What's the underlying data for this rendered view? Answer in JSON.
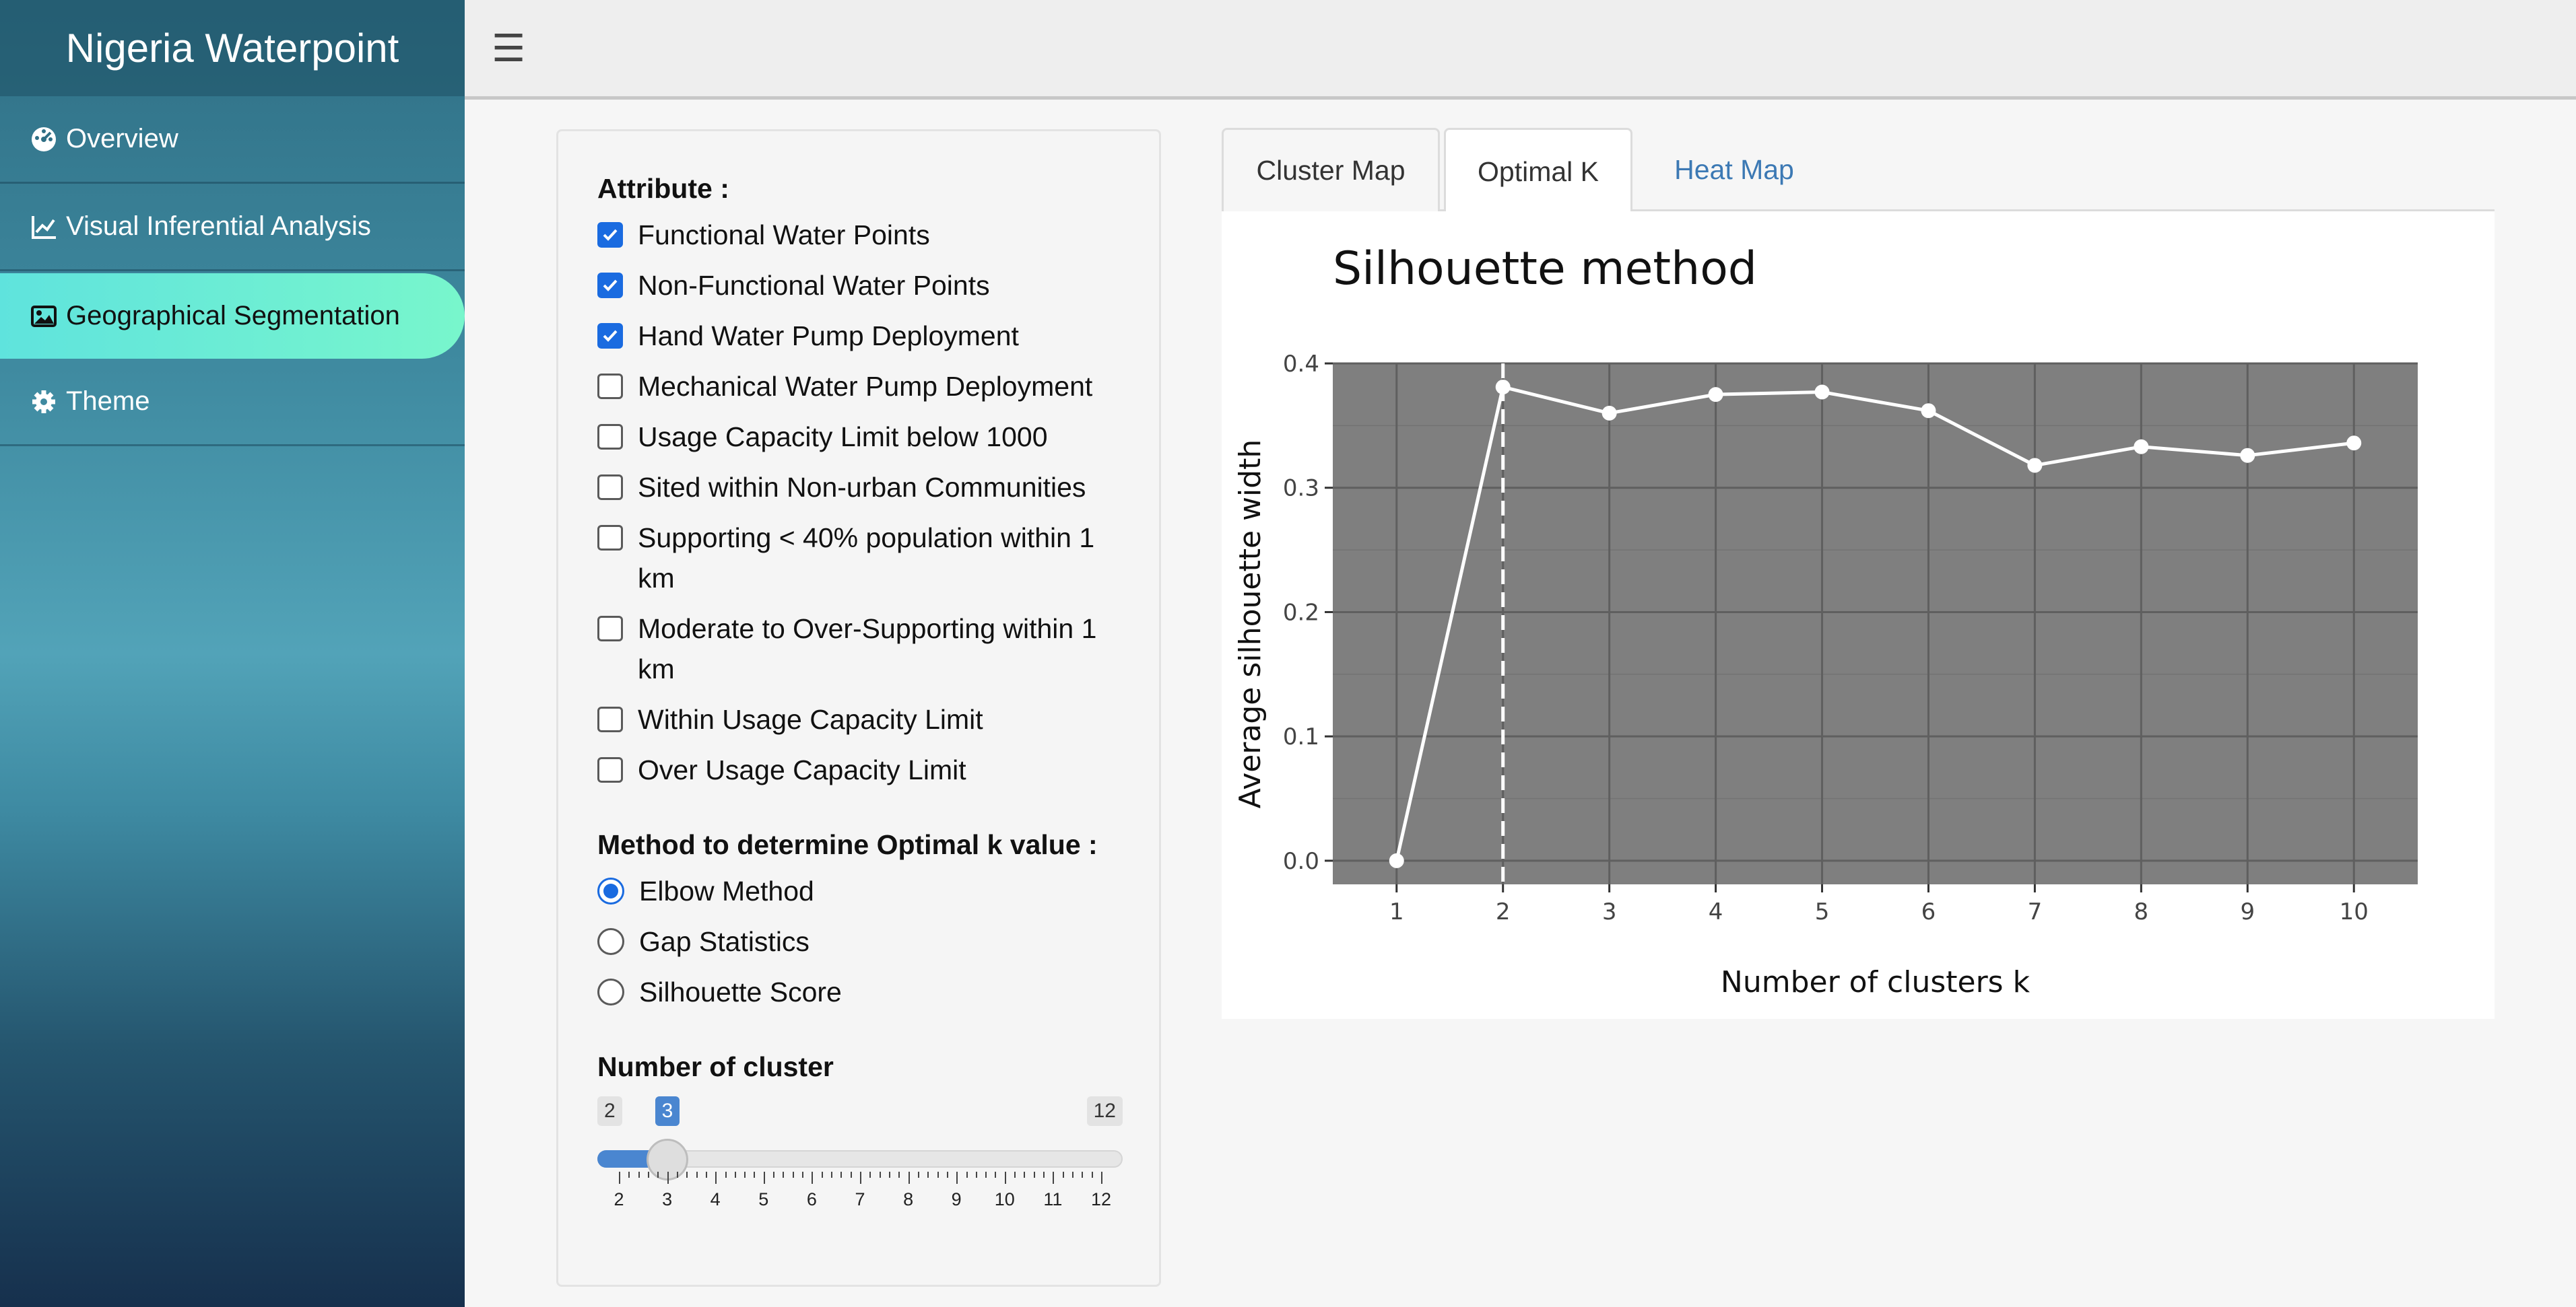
{
  "sidebar": {
    "brand": "Nigeria Waterpoint",
    "items": [
      {
        "label": "Overview",
        "icon": "dashboard-icon"
      },
      {
        "label": "Visual Inferential Analysis",
        "icon": "line-chart-icon"
      },
      {
        "label": "Geographical Segmentation",
        "icon": "image-icon",
        "active": true
      },
      {
        "label": "Theme",
        "icon": "gear-icon"
      }
    ]
  },
  "header": {
    "menu_icon": "hamburger-icon"
  },
  "panel": {
    "attribute_label": "Attribute :",
    "attributes": [
      {
        "label": "Functional Water Points",
        "checked": true
      },
      {
        "label": "Non-Functional Water Points",
        "checked": true
      },
      {
        "label": "Hand Water Pump Deployment",
        "checked": true
      },
      {
        "label": "Mechanical Water Pump Deployment",
        "checked": false
      },
      {
        "label": "Usage Capacity Limit below 1000",
        "checked": false
      },
      {
        "label": "Sited within Non-urban Communities",
        "checked": false
      },
      {
        "label": "Supporting < 40% population within 1 km",
        "checked": false
      },
      {
        "label": "Moderate to Over-Supporting within 1 km",
        "checked": false
      },
      {
        "label": "Within Usage Capacity Limit",
        "checked": false
      },
      {
        "label": "Over Usage Capacity Limit",
        "checked": false
      }
    ],
    "method_label": "Method to determine Optimal k value :",
    "methods": [
      {
        "label": "Elbow Method",
        "checked": true
      },
      {
        "label": "Gap Statistics",
        "checked": false
      },
      {
        "label": "Silhouette Score",
        "checked": false
      }
    ],
    "cluster_label": "Number of cluster",
    "slider": {
      "min": 2,
      "max": 12,
      "value": 3,
      "min_label": "2",
      "max_label": "12",
      "value_label": "3",
      "tick_labels": [
        "2",
        "3",
        "4",
        "5",
        "6",
        "7",
        "8",
        "9",
        "10",
        "11",
        "12"
      ]
    }
  },
  "tabs": [
    {
      "label": "Cluster Map",
      "state": "inactive"
    },
    {
      "label": "Optimal K",
      "state": "active"
    },
    {
      "label": "Heat Map",
      "state": "link"
    }
  ],
  "chart_data": {
    "type": "line",
    "title": "Silhouette method",
    "xlabel": "Number of clusters k",
    "ylabel": "Average silhouette width",
    "x": [
      1,
      2,
      3,
      4,
      5,
      6,
      7,
      8,
      9,
      10
    ],
    "y": [
      0.0,
      0.381,
      0.36,
      0.375,
      0.377,
      0.362,
      0.318,
      0.333,
      0.326,
      0.336
    ],
    "x_tick_labels": [
      "1",
      "2",
      "3",
      "4",
      "5",
      "6",
      "7",
      "8",
      "9",
      "10"
    ],
    "y_ticks": [
      0.0,
      0.1,
      0.2,
      0.3,
      0.4
    ],
    "y_tick_labels": [
      "0.0",
      "0.1",
      "0.2",
      "0.3",
      "0.4"
    ],
    "xlim": [
      0.4,
      10.6
    ],
    "ylim": [
      -0.019,
      0.4
    ],
    "optimal_k": 2,
    "grid": true,
    "panel_background": "#7f7f7f",
    "line_color": "#ffffff"
  }
}
